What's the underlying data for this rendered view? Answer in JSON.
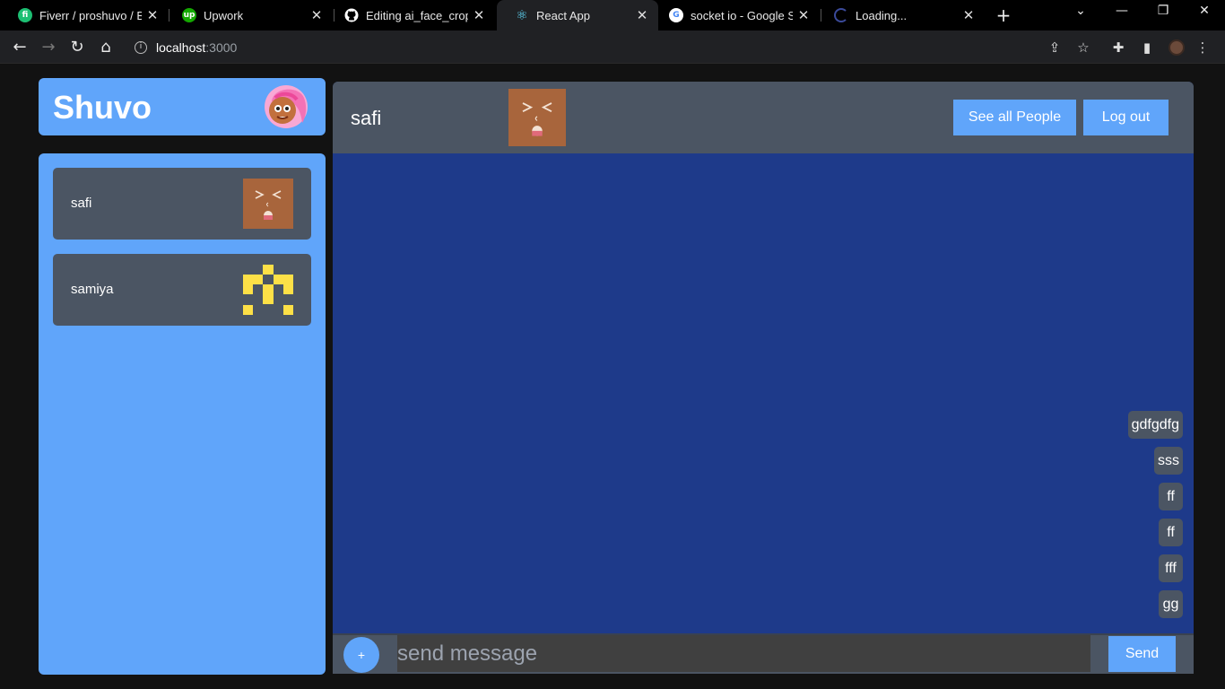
{
  "browser": {
    "tabs": [
      {
        "label": "Fiverr / proshuvo / Buy",
        "icon": "fiverr-icon",
        "color": "#1dbf73",
        "glyph": "fi"
      },
      {
        "label": "Upwork",
        "icon": "upwork-icon",
        "color": "#14a800",
        "glyph": "up"
      },
      {
        "label": "Editing ai_face_crop/R",
        "icon": "github-icon",
        "color": "#ffffff",
        "glyph": ""
      },
      {
        "label": "React App",
        "icon": "react-icon",
        "color": "#61dafb",
        "glyph": "⚛"
      },
      {
        "label": "socket io - Google Sea",
        "icon": "google-icon",
        "color": "#ffffff",
        "glyph": "G"
      },
      {
        "label": "Loading...",
        "icon": "loading-spinner-icon",
        "color": "#202124",
        "glyph": ""
      }
    ],
    "url_host": "localhost",
    "url_port": ":3000"
  },
  "brand": {
    "name": "Shuvo"
  },
  "contacts": [
    {
      "name": "safi"
    },
    {
      "name": "samiya"
    }
  ],
  "chat": {
    "name": "safi",
    "see_all_label": "See all People",
    "logout_label": "Log out",
    "messages": [
      "gdfgdfg",
      "sss",
      "ff",
      "ff",
      "fff",
      "gg"
    ],
    "input_placeholder": "send message",
    "plus_label": "+",
    "send_label": "Send"
  },
  "colors": {
    "accent": "#60a5fa",
    "panel": "#4b5563",
    "chat_bg": "#1e3a8a",
    "page_bg": "#121212"
  }
}
